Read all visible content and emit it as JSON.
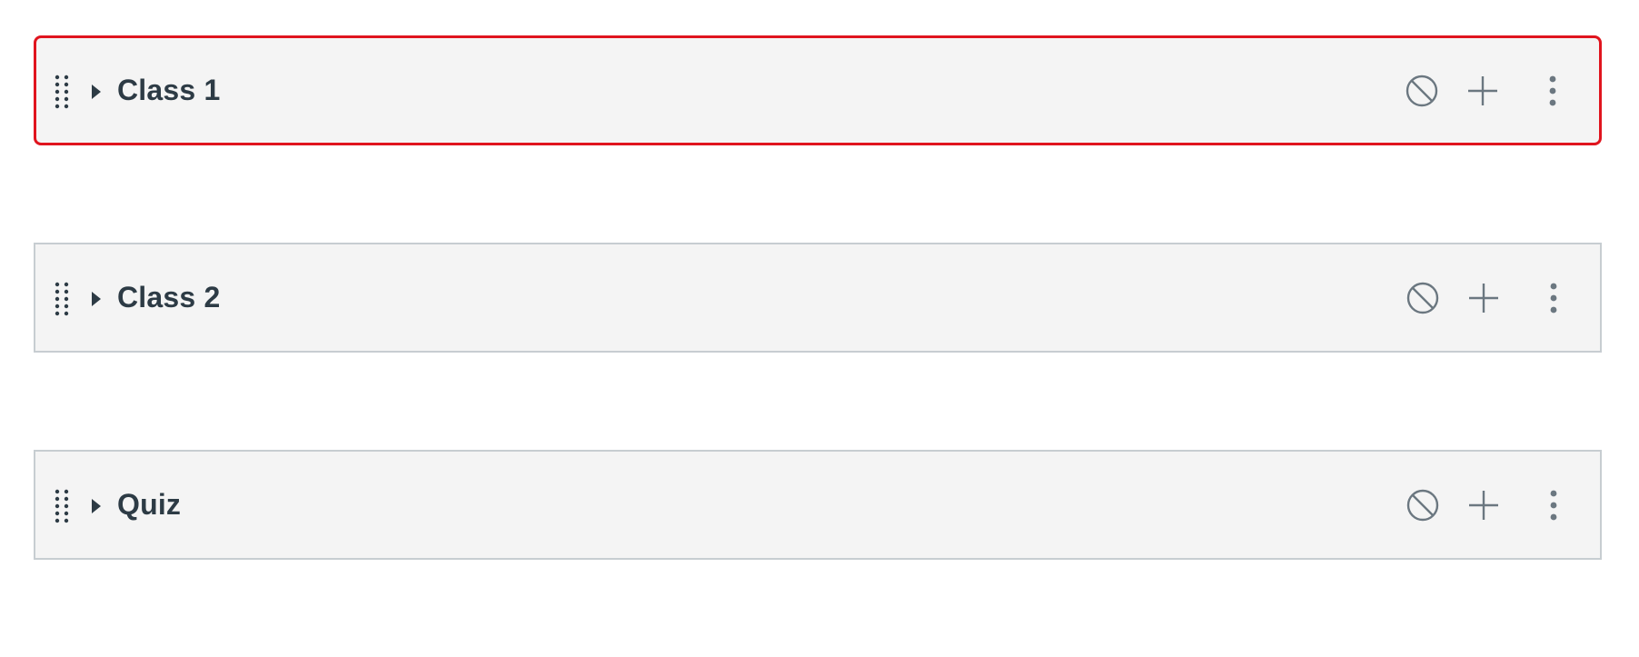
{
  "modules": [
    {
      "title": "Class 1",
      "selected": true,
      "icons": {
        "drag": "drag-handle-icon",
        "expand": "expand-arrow-icon",
        "publish": "unpublished-icon",
        "add": "plus-icon",
        "menu": "kebab-menu-icon"
      }
    },
    {
      "title": "Class 2",
      "selected": false,
      "icons": {
        "drag": "drag-handle-icon",
        "expand": "expand-arrow-icon",
        "publish": "unpublished-icon",
        "add": "plus-icon",
        "menu": "kebab-menu-icon"
      }
    },
    {
      "title": "Quiz",
      "selected": false,
      "icons": {
        "drag": "drag-handle-icon",
        "expand": "expand-arrow-icon",
        "publish": "unpublished-icon",
        "add": "plus-icon",
        "menu": "kebab-menu-icon"
      }
    }
  ],
  "colors": {
    "header_background": "#f4f4f4",
    "header_border": "#c7cdd1",
    "selected_border": "#e0141e",
    "title_text": "#2d3b45",
    "icon_gray": "#6b7780",
    "icon_dark": "#2d3b45"
  }
}
